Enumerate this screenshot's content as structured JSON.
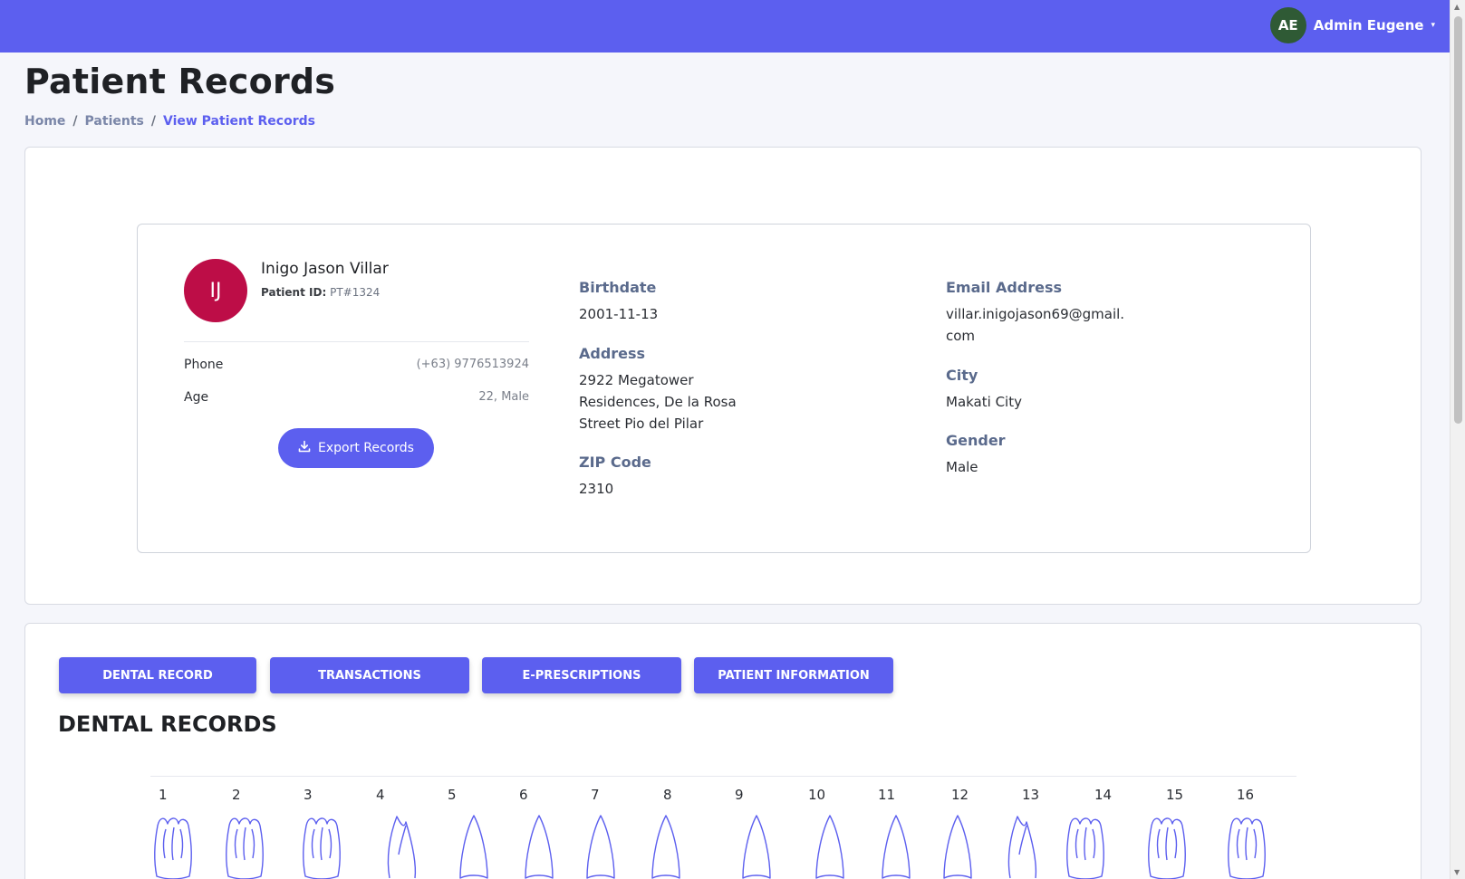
{
  "header": {
    "avatar_initials": "AE",
    "user_name": "Admin Eugene",
    "caret": "▾"
  },
  "page": {
    "title": "Patient Records"
  },
  "breadcrumb": {
    "home": "Home",
    "separator": "/",
    "patients": "Patients",
    "current": "View Patient Records"
  },
  "patient": {
    "initials": "IJ",
    "name": "Inigo Jason Villar",
    "id_label": "Patient ID:",
    "id_value": "PT#1324",
    "phone_label": "Phone",
    "phone_value": "(+63) 9776513924",
    "age_label": "Age",
    "age_value": "22, Male",
    "export_label": "Export Records",
    "export_icon": "download-icon",
    "birthdate_label": "Birthdate",
    "birthdate_value": "2001-11-13",
    "address_label": "Address",
    "address_line1": "2922 Megatower",
    "address_line2": "Residences, De la Rosa",
    "address_line3": "Street Pio del Pilar",
    "zip_label": "ZIP Code",
    "zip_value": "2310",
    "email_label": "Email Address",
    "email_line1": "villar.inigojason69@gmail.",
    "email_line2": "com",
    "city_label": "City",
    "city_value": "Makati City",
    "gender_label": "Gender",
    "gender_value": "Male"
  },
  "tabs": [
    {
      "label": "DENTAL RECORD"
    },
    {
      "label": "TRANSACTIONS"
    },
    {
      "label": "E-PRESCRIPTIONS"
    },
    {
      "label": "PATIENT INFORMATION"
    }
  ],
  "dental": {
    "section_title": "DENTAL RECORDS",
    "teeth": [
      "1",
      "2",
      "3",
      "4",
      "5",
      "6",
      "7",
      "8",
      "9",
      "10",
      "11",
      "12",
      "13",
      "14",
      "15",
      "16"
    ]
  },
  "colors": {
    "accent": "#5c5fef",
    "avatar_patient": "#bd0d47",
    "avatar_user": "#2f5a35",
    "tooth_stroke": "#5c5fef"
  }
}
